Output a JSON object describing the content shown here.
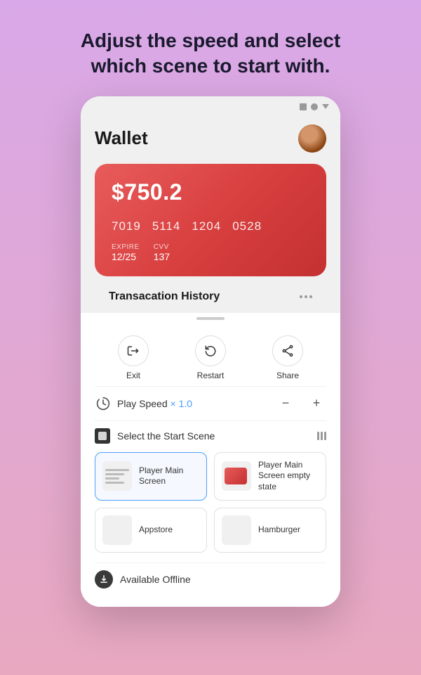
{
  "headline": {
    "line1": "Adjust the speed and select",
    "line2": "which scene to start with."
  },
  "phone": {
    "topbar_icons": [
      "square",
      "circle",
      "chevron"
    ]
  },
  "wallet": {
    "title": "Wallet",
    "card": {
      "balance": "$750.2",
      "number_parts": [
        "7019",
        "5114",
        "1204",
        "0528"
      ],
      "expire_label": "EXPIRE",
      "expire_value": "12/25",
      "cvv_label": "CVV",
      "cvv_value": "137"
    },
    "transaction_title": "Transacation History"
  },
  "controls": {
    "exit_label": "Exit",
    "restart_label": "Restart",
    "share_label": "Share",
    "play_speed_label": "Play Speed",
    "speed_value": "× 1.0",
    "minus_label": "−",
    "plus_label": "+",
    "select_scene_label": "Select the Start Scene"
  },
  "scenes": [
    {
      "id": "player-main",
      "name": "Player Main Screen",
      "selected": true
    },
    {
      "id": "player-empty",
      "name": "Player Main Screen empty state",
      "selected": false
    },
    {
      "id": "appstore",
      "name": "Appstore",
      "selected": false
    },
    {
      "id": "hamburger",
      "name": "Hamburger",
      "selected": false
    }
  ],
  "offline": {
    "label": "Available Offline"
  }
}
